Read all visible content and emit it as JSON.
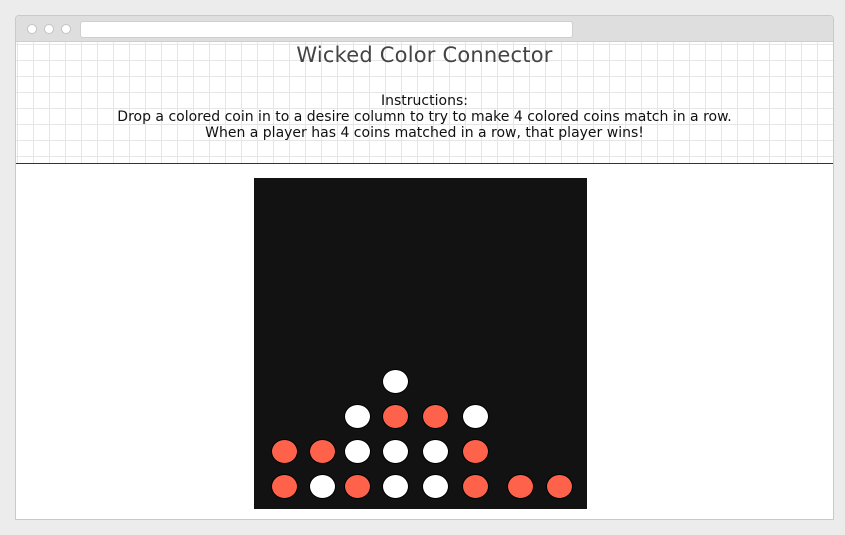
{
  "app": {
    "title": "Wicked Color Connector"
  },
  "instructions": {
    "heading": "Instructions:",
    "line1": "Drop a colored coin in to a desire column to try to make 4 colored coins match in a row.",
    "line2": "When a player has 4 coins matched in a row, that player wins!"
  },
  "colors": {
    "red": "#ff624a",
    "white": "#ffffff",
    "board": "#121212"
  },
  "board": {
    "columns": 8,
    "rows": 9,
    "grid_bottom_up": [
      [
        "red",
        "white",
        "red",
        "white",
        "white",
        "red",
        "red",
        "red"
      ],
      [
        "red",
        "red",
        "white",
        "white",
        "white",
        "red",
        null,
        null
      ],
      [
        null,
        null,
        "white",
        "red",
        "red",
        "white",
        null,
        null
      ],
      [
        null,
        null,
        null,
        "white",
        null,
        null,
        null,
        null
      ]
    ]
  }
}
